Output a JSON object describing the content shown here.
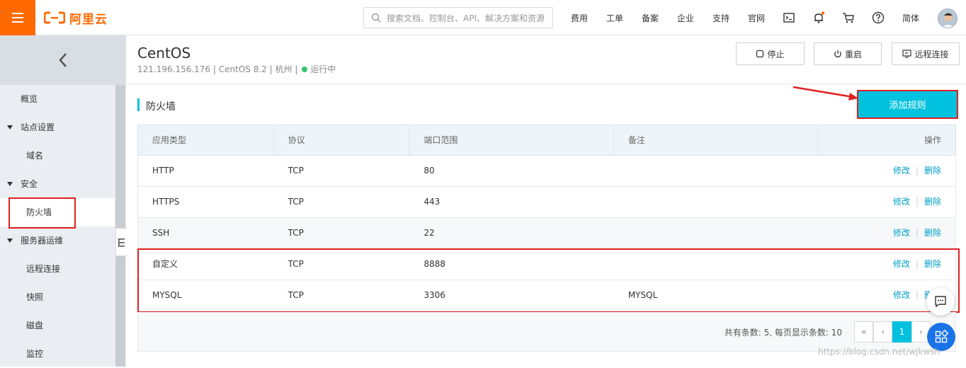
{
  "brand": {
    "name": "阿里云",
    "color": "#ff6a00"
  },
  "search": {
    "placeholder": "搜索文档、控制台、API、解决方案和资源"
  },
  "nav": {
    "items": [
      "费用",
      "工单",
      "备案",
      "企业",
      "支持",
      "官网"
    ],
    "icons": [
      "terminal-icon",
      "bell-icon",
      "cart-icon",
      "help-icon"
    ],
    "lang": "简体"
  },
  "sidebar": {
    "items": [
      {
        "label": "概览",
        "type": "top"
      },
      {
        "label": "站点设置",
        "type": "group"
      },
      {
        "label": "域名",
        "type": "sub"
      },
      {
        "label": "安全",
        "type": "group"
      },
      {
        "label": "防火墙",
        "type": "sub",
        "active": true
      },
      {
        "label": "服务器运维",
        "type": "group"
      },
      {
        "label": "远程连接",
        "type": "sub"
      },
      {
        "label": "快照",
        "type": "sub"
      },
      {
        "label": "磁盘",
        "type": "sub"
      },
      {
        "label": "监控",
        "type": "sub"
      }
    ]
  },
  "instance": {
    "title": "CentOS",
    "ip": "121.196.156.176",
    "os": "CentOS 8.2",
    "region": "杭州",
    "status": "运行中",
    "sep": "|"
  },
  "actions": {
    "stop": "停止",
    "restart": "重启",
    "remote": "远程连接"
  },
  "section": {
    "title": "防火墙",
    "add_button": "添加规则"
  },
  "table": {
    "headers": [
      "应用类型",
      "协议",
      "端口范围",
      "备注",
      "操作"
    ],
    "rows": [
      {
        "app": "HTTP",
        "protocol": "TCP",
        "port": "80",
        "note": ""
      },
      {
        "app": "HTTPS",
        "protocol": "TCP",
        "port": "443",
        "note": ""
      },
      {
        "app": "SSH",
        "protocol": "TCP",
        "port": "22",
        "note": ""
      },
      {
        "app": "自定义",
        "protocol": "TCP",
        "port": "8888",
        "note": ""
      },
      {
        "app": "MYSQL",
        "protocol": "TCP",
        "port": "3306",
        "note": "MYSQL"
      }
    ],
    "op_edit": "修改",
    "op_delete": "删除",
    "op_sep": "|"
  },
  "pager": {
    "info": "共有条数: 5, 每页显示条数: 10",
    "first": "«",
    "prev": "‹",
    "current": "1",
    "next": "›"
  },
  "watermark": "https://blog.csdn.net/wjkwsh",
  "colors": {
    "accent": "#00c1de",
    "highlight": "#e02020",
    "running": "#36c66a"
  }
}
